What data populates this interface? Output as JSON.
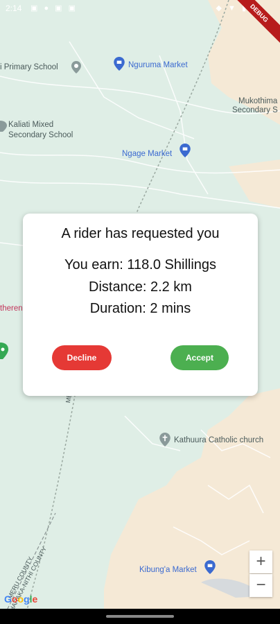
{
  "status_bar": {
    "time": "2:14",
    "left_icons": "▣ ● ▣ ▣",
    "right_icons": "◆ ▼ ▮"
  },
  "debug_banner": "DEBUG",
  "map": {
    "places": [
      {
        "id": "primary-school",
        "label": "i Primary School",
        "color": "gray"
      },
      {
        "id": "nguruma-market",
        "label": "Nguruma Market",
        "color": "blue"
      },
      {
        "id": "mukothima-1",
        "label": "Mukothima",
        "color": "gray"
      },
      {
        "id": "mukothima-2",
        "label": "Secondary S",
        "color": "gray"
      },
      {
        "id": "kaliati-1",
        "label": "Kaliati Mixed",
        "color": "gray"
      },
      {
        "id": "kaliati-2",
        "label": "Secondary School",
        "color": "gray"
      },
      {
        "id": "ngage-market",
        "label": "Ngage Market",
        "color": "blue"
      },
      {
        "id": "therene",
        "label": "therene",
        "color": "red"
      },
      {
        "id": "meru-road",
        "label": "MERU",
        "color": "gray"
      },
      {
        "id": "kathuura-church",
        "label": "Kathuura Catholic church",
        "color": "gray"
      },
      {
        "id": "meru-county",
        "label": "MERU COUNTY",
        "color": "gray"
      },
      {
        "id": "tharaka-county",
        "label": "THARAKA-NITHI COUNTY",
        "color": "gray"
      },
      {
        "id": "kibunga-market",
        "label": "Kibung'a Market",
        "color": "blue"
      }
    ],
    "zoom_in": "+",
    "zoom_out": "−",
    "attribution": "Google"
  },
  "dialog": {
    "title": "A rider has requested you",
    "earn": "You earn: 118.0 Shillings",
    "distance": "Distance: 2.2 km",
    "duration": "Duration: 2 mins",
    "decline_label": "Decline",
    "accept_label": "Accept"
  },
  "colors": {
    "map_green": "#dfeee6",
    "map_sand": "#f5e9d6",
    "decline": "#e53935",
    "accept": "#4caf50",
    "poi_blue": "#3b6ad0"
  }
}
